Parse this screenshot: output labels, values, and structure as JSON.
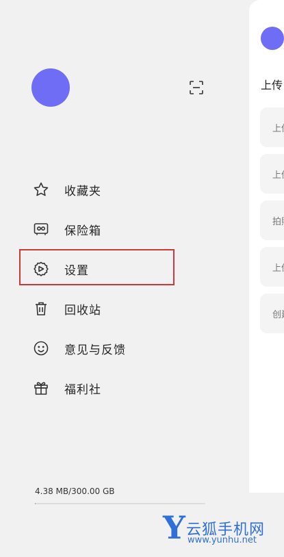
{
  "drawer": {
    "menu": [
      {
        "label": "收藏夹",
        "icon": "star-icon"
      },
      {
        "label": "保险箱",
        "icon": "safe-icon"
      },
      {
        "label": "设置",
        "icon": "settings-icon"
      },
      {
        "label": "回收站",
        "icon": "trash-icon"
      },
      {
        "label": "意见与反馈",
        "icon": "smiley-icon"
      },
      {
        "label": "福利社",
        "icon": "gift-icon"
      }
    ],
    "storage_text": "4.38 MB/300.00 GB",
    "storage_used_fraction": 1.46e-05
  },
  "panel": {
    "title": "上传",
    "cards": [
      "上传",
      "上传",
      "拍照",
      "上传",
      "创建"
    ]
  },
  "watermark": {
    "letter": "Y",
    "title": "云狐手机网",
    "url": "www.yunhu.net"
  },
  "colors": {
    "avatar": "#6f6cf6",
    "highlight": "#d1373a",
    "watermark": "#2f6fd8"
  }
}
